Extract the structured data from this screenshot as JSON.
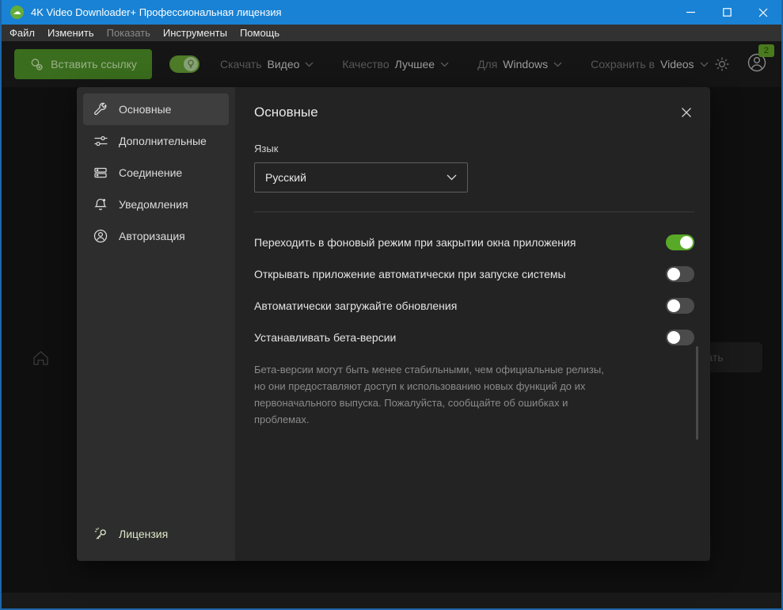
{
  "window": {
    "title": "4K Video Downloader+ Профессиональная лицензия"
  },
  "menu": {
    "items": [
      {
        "label": "Файл",
        "disabled": false
      },
      {
        "label": "Изменить",
        "disabled": false
      },
      {
        "label": "Показать",
        "disabled": true
      },
      {
        "label": "Инструменты",
        "disabled": false
      },
      {
        "label": "Помощь",
        "disabled": false
      }
    ]
  },
  "toolbar": {
    "paste_button": "Вставить ссылку",
    "smart_mode_on": true,
    "download_label": "Скачать",
    "download_value": "Видео",
    "quality_label": "Качество",
    "quality_value": "Лучшее",
    "platform_label": "Для",
    "platform_value": "Windows",
    "save_label": "Сохранить в",
    "save_value": "Videos",
    "notifications_badge": "2"
  },
  "background": {
    "search_placeholder": "Искать"
  },
  "settings": {
    "sidebar": {
      "items": [
        {
          "label": "Основные",
          "icon": "wrench-icon",
          "selected": true
        },
        {
          "label": "Дополнительные",
          "icon": "sliders-icon",
          "selected": false
        },
        {
          "label": "Соединение",
          "icon": "connection-icon",
          "selected": false
        },
        {
          "label": "Уведомления",
          "icon": "bell-icon",
          "selected": false
        },
        {
          "label": "Авторизация",
          "icon": "person-icon",
          "selected": false
        }
      ],
      "license_label": "Лицензия"
    },
    "title": "Основные",
    "language": {
      "label": "Язык",
      "value": "Русский"
    },
    "toggles": [
      {
        "label": "Переходить в фоновый режим при закрытии окна приложения",
        "on": true
      },
      {
        "label": "Открывать приложение автоматически при запуске системы",
        "on": false
      },
      {
        "label": "Автоматически загружайте обновления",
        "on": false
      },
      {
        "label": "Устанавливать бета-версии",
        "on": false
      }
    ],
    "beta_note": "Бета-версии могут быть менее стабильными, чем официальные релизы, но они предоставляют доступ к использованию новых функций до их первоначального выпуска. Пожалуйста, сообщайте об ошибках и проблемах."
  },
  "colors": {
    "titlebar_blue": "#1982d4",
    "accent_green": "#58a928",
    "toolbar_button_green": "#3a6d1d",
    "license_tint": "#dde8c9",
    "app_icon_green": "#63ad3a"
  }
}
